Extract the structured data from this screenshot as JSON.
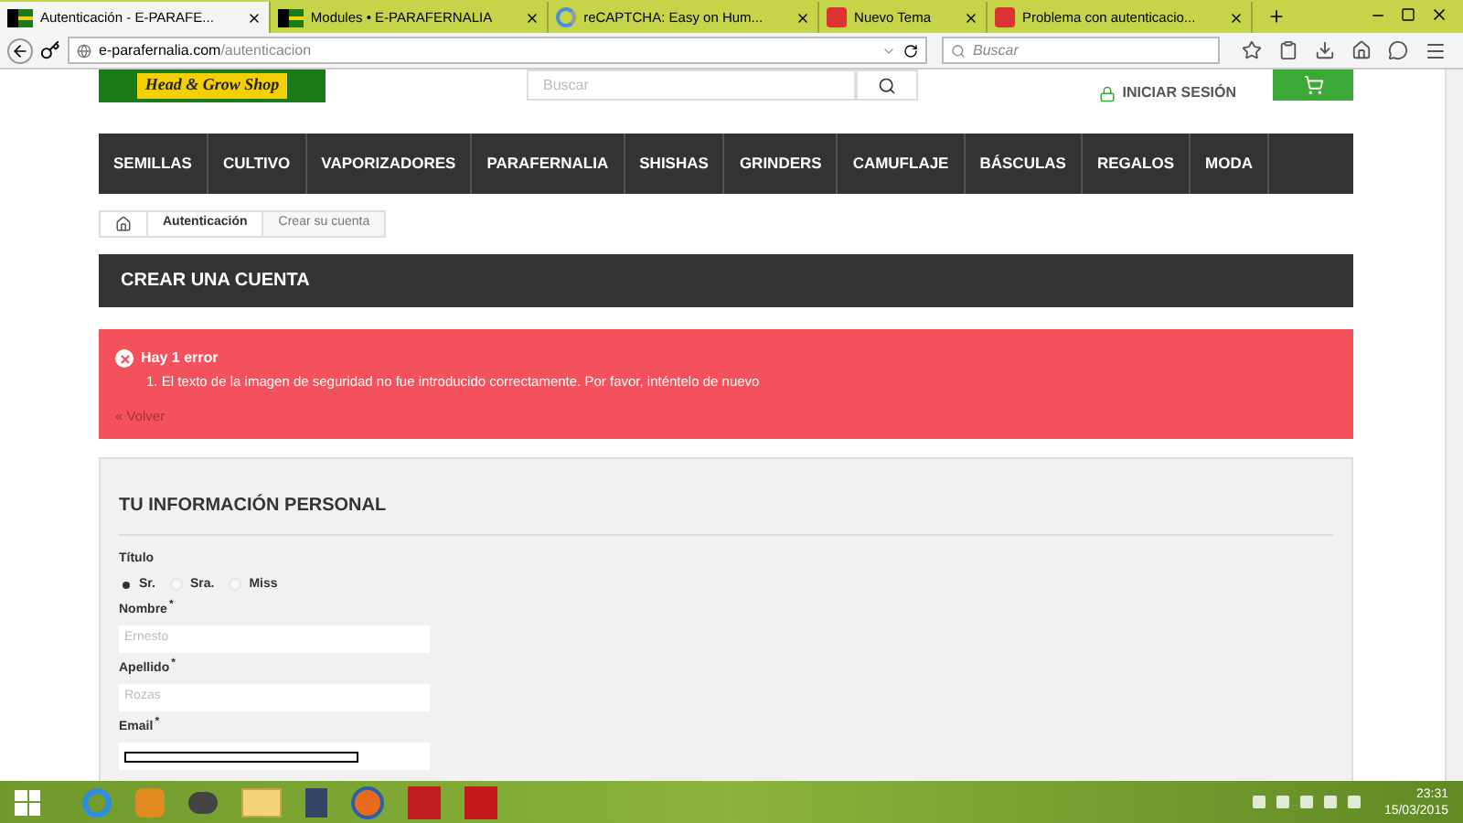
{
  "browser": {
    "tabs": [
      {
        "label": "Autenticación - E-PARAFE...",
        "selected": true,
        "kind": "flag"
      },
      {
        "label": "Modules • E-PARAFERNALIA",
        "selected": false,
        "kind": "flag"
      },
      {
        "label": "reCAPTCHA: Easy on Hum...",
        "selected": false,
        "kind": "recaptcha"
      },
      {
        "label": "Nuevo Tema",
        "selected": false,
        "kind": "w"
      },
      {
        "label": "Problema con autenticacio...",
        "selected": false,
        "kind": "w"
      }
    ],
    "url_host": "e-parafernalia.com",
    "url_path": "/autenticacion",
    "search_placeholder": "Buscar"
  },
  "header": {
    "logo_text": "Head & Grow Shop",
    "search_placeholder": "Buscar",
    "login": "INICIAR SESIÓN"
  },
  "nav": [
    "SEMILLAS",
    "CULTIVO",
    "VAPORIZADORES",
    "PARAFERNALIA",
    "SHISHAS",
    "GRINDERS",
    "CAMUFLAJE",
    "BÁSCULAS",
    "REGALOS",
    "MODA"
  ],
  "breadcrumb": [
    "Autenticación",
    "Crear su cuenta"
  ],
  "page_title": "CREAR UNA CUENTA",
  "error": {
    "title": "Hay 1 error",
    "items": [
      "1. El texto de la imagen de seguridad no fue introducido correctamente. Por favor, inténtelo de nuevo"
    ],
    "back": "« Volver"
  },
  "form": {
    "required_mark": "*",
    "heading": "TU INFORMACIÓN PERSONAL",
    "title_label": "Título",
    "titles": [
      {
        "label": "Sr.",
        "selected": true
      },
      {
        "label": "Sra.",
        "selected": false
      },
      {
        "label": "Miss",
        "selected": false
      }
    ],
    "fields": [
      {
        "label": "Nombre",
        "required": true,
        "placeholder": "Ernesto"
      },
      {
        "label": "Apellido",
        "required": true,
        "placeholder": "Rozas"
      },
      {
        "label": "Email",
        "required": true
      }
    ]
  },
  "taskbar": {
    "time": "23:31",
    "date": "15/03/2015"
  }
}
